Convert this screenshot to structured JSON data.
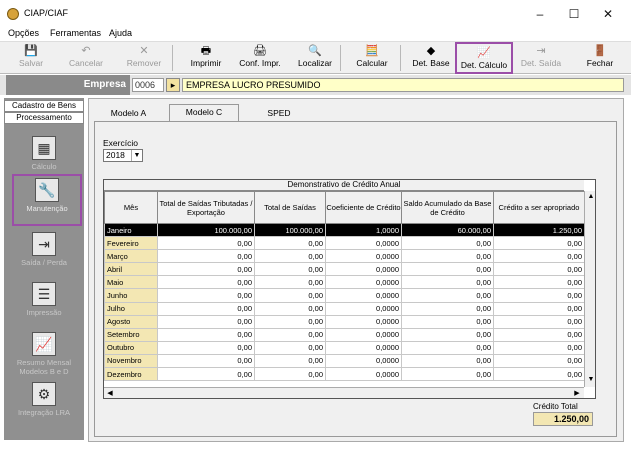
{
  "window": {
    "title": "CIAP/CIAF",
    "controls": {
      "minimize": "–",
      "maximize": "☐",
      "close": "✕"
    }
  },
  "menu": [
    "Opções",
    "Ferramentas",
    "Ajuda"
  ],
  "toolbar": [
    {
      "label": "Salvar",
      "icon": "save-icon",
      "glyph": "💾",
      "disabled": true
    },
    {
      "label": "Cancelar",
      "icon": "undo-icon",
      "glyph": "↶",
      "disabled": true
    },
    {
      "label": "Remover",
      "icon": "remove-icon",
      "glyph": "✕",
      "disabled": true
    },
    {
      "label": "Imprimir",
      "icon": "printer-icon",
      "glyph": "🖶",
      "disabled": false
    },
    {
      "label": "Conf. Impr.",
      "icon": "printer-settings-icon",
      "glyph": "🖨",
      "disabled": false
    },
    {
      "label": "Localizar",
      "icon": "search-icon",
      "glyph": "🔍",
      "disabled": false
    },
    {
      "label": "Calcular",
      "icon": "calculator-icon",
      "glyph": "🧮",
      "disabled": false
    },
    {
      "label": "Det. Base",
      "icon": "detail-base-icon",
      "glyph": "◆",
      "disabled": false
    },
    {
      "label": "Det. Cálculo",
      "icon": "chart-icon",
      "glyph": "📈",
      "disabled": false
    },
    {
      "label": "Det. Saída",
      "icon": "detail-exit-icon",
      "glyph": "⇥",
      "disabled": true
    },
    {
      "label": "Fechar",
      "icon": "exit-door-icon",
      "glyph": "🚪",
      "disabled": false
    }
  ],
  "empresa": {
    "label": "Empresa",
    "code": "0006",
    "name": "EMPRESA LUCRO PRESUMIDO"
  },
  "sidebar": {
    "tabs": [
      "Cadastro de Bens",
      "Processamento"
    ],
    "items": [
      "Cálculo",
      "Manutenção",
      "Saída / Perda",
      "Impressão",
      "Resumo Mensal Modelos B e D",
      "Integração LRA"
    ]
  },
  "tabs": [
    "Modelo A",
    "Modelo C",
    "SPED"
  ],
  "exercicio": {
    "label": "Exercício",
    "value": "2018"
  },
  "grid": {
    "caption": "Demonstrativo de Crédito Anual",
    "headers": [
      "Mês",
      "Total de Saídas Tributadas / Exportação",
      "Total de Saídas",
      "Coeficiente de Crédito",
      "Saldo Acumulado da Base de Crédito",
      "Crédito a ser apropriado"
    ],
    "rows": [
      [
        "Janeiro",
        "100.000,00",
        "100.000,00",
        "1,0000",
        "60.000,00",
        "1.250,00"
      ],
      [
        "Fevereiro",
        "0,00",
        "0,00",
        "0,0000",
        "0,00",
        "0,00"
      ],
      [
        "Março",
        "0,00",
        "0,00",
        "0,0000",
        "0,00",
        "0,00"
      ],
      [
        "Abril",
        "0,00",
        "0,00",
        "0,0000",
        "0,00",
        "0,00"
      ],
      [
        "Maio",
        "0,00",
        "0,00",
        "0,0000",
        "0,00",
        "0,00"
      ],
      [
        "Junho",
        "0,00",
        "0,00",
        "0,0000",
        "0,00",
        "0,00"
      ],
      [
        "Julho",
        "0,00",
        "0,00",
        "0,0000",
        "0,00",
        "0,00"
      ],
      [
        "Agosto",
        "0,00",
        "0,00",
        "0,0000",
        "0,00",
        "0,00"
      ],
      [
        "Setembro",
        "0,00",
        "0,00",
        "0,0000",
        "0,00",
        "0,00"
      ],
      [
        "Outubro",
        "0,00",
        "0,00",
        "0,0000",
        "0,00",
        "0,00"
      ],
      [
        "Novembro",
        "0,00",
        "0,00",
        "0,0000",
        "0,00",
        "0,00"
      ],
      [
        "Dezembro",
        "0,00",
        "0,00",
        "0,0000",
        "0,00",
        "0,00"
      ]
    ]
  },
  "credito_total": {
    "label": "Crédito Total",
    "value": "1.250,00"
  },
  "colors": {
    "highlight": "#9b4ea8",
    "selected_row": "#000000",
    "month_cell": "#f3e7b3",
    "empresa_name_bg": "#ffffc8"
  }
}
